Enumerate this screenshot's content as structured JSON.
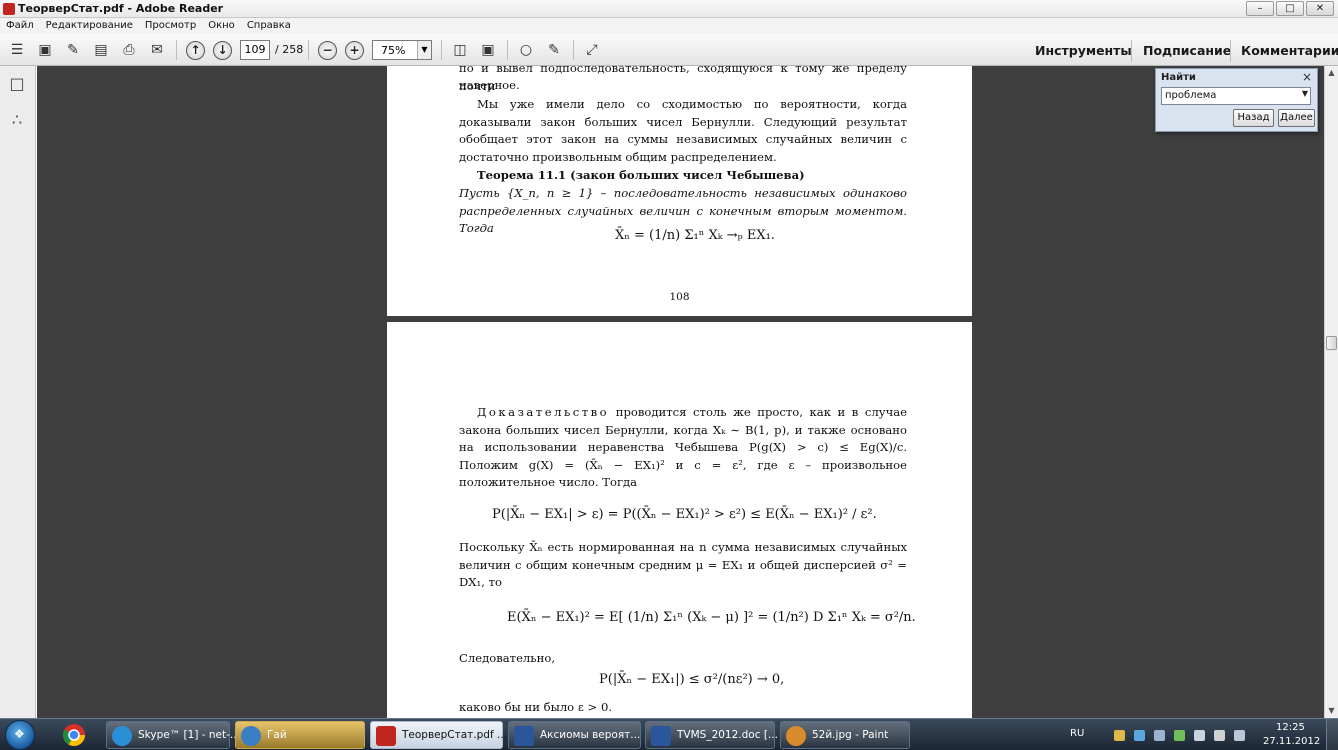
{
  "window": {
    "title": "ТеорверСтат.pdf - Adobe Reader",
    "minimize": "–",
    "maximize": "□",
    "close": "✕"
  },
  "menu": [
    "Файл",
    "Редактирование",
    "Просмотр",
    "Окно",
    "Справка"
  ],
  "toolbar": {
    "page_current": "109",
    "page_total": "/ 258",
    "zoom": "75%",
    "right_tabs": [
      "Инструменты",
      "Подписание",
      "Комментарии"
    ]
  },
  "find": {
    "title": "Найти",
    "close": "×",
    "query": "проблема",
    "back_label": "Назад",
    "next_label": "Далее"
  },
  "document": {
    "page1": {
      "line0": "по и вывел подпоследовательность, сходящуюся к тому же пределу почти",
      "line1": "наверное.",
      "para1": "Мы уже имели дело со сходимостью по вероятности, когда доказывали закон больших чисел Бернулли. Следующий результат обобщает этот закон на суммы независимых случайных величин с достаточно произвольным общим распределением.",
      "theorem_title": "Теорема 11.1 (закон больших чисел Чебышева)",
      "theorem_text": "Пусть {X_n, n ≥ 1} – последовательность независимых одинаково распределенных случайных величин с конечным вторым моментом. Тогда",
      "formula1": "X̄ₙ = (1/n) Σ₁ⁿ Xₖ →ₚ EX₁.",
      "page_number": "108"
    },
    "page2": {
      "proof_word": "Доказательство",
      "para1": "проводится столь же просто, как и в случае закона больших чисел Бернулли, когда Xₖ ∼ B(1, p), и также основано на использовании неравенства Чебышева P(g(X) > c) ≤ Eg(X)/c. Положим g(X) = (X̄ₙ − EX₁)² и c = ε², где ε – произвольное положительное число. Тогда",
      "formula1": "P(|X̄ₙ − EX₁| > ε) = P((X̄ₙ − EX₁)² > ε²) ≤ E(X̄ₙ − EX₁)² / ε².",
      "para2": "Поскольку X̄ₙ есть нормированная на n сумма независимых случайных величин с общим конечным средним μ = EX₁ и общей дисперсией σ² = DX₁, то",
      "formula2": "E(X̄ₙ − EX₁)² = E[ (1/n) Σ₁ⁿ (Xₖ − μ) ]² = (1/n²) D Σ₁ⁿ Xₖ = σ²/n.",
      "para3": "Следовательно,",
      "formula3": "P(|X̄ₙ − EX₁|) ≤ σ²/(nε²) → 0,",
      "para4": "каково бы ни было ε > 0."
    }
  },
  "taskbar": {
    "items": [
      {
        "label": "Skype™ [1] - net-...",
        "color": "#2a8fd6"
      },
      {
        "label": "Гай",
        "color": "#3a7fc4"
      },
      {
        "label": "ТеорверСтат.pdf ...",
        "color": "#c0261d"
      },
      {
        "label": "Аксиомы вероят...",
        "color": "#2b579a"
      },
      {
        "label": "TVMS_2012.doc [...",
        "color": "#2b579a"
      },
      {
        "label": "52й.jpg - Paint",
        "color": "#d98a2a"
      }
    ],
    "lang": "RU",
    "time": "12:25",
    "date": "27.11.2012"
  },
  "colors": {
    "doc_background": "#3f3f3f",
    "toolbar": "#e9e9e9",
    "find_panel": "#d9e2ef",
    "taskbar": "#1c2633"
  }
}
